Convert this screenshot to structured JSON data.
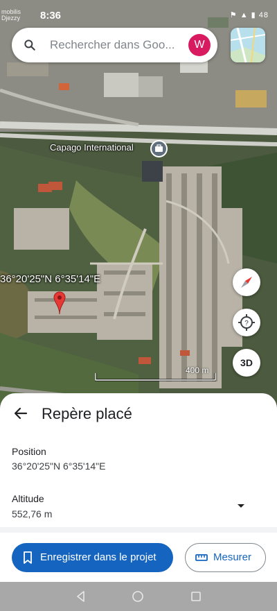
{
  "status": {
    "carrier": "mobilis\nDjezzy",
    "time": "8:36",
    "icons": "⚑ ▲ ▮ 48"
  },
  "search": {
    "placeholder": "Rechercher dans Goo...",
    "avatar_letter": "W"
  },
  "map": {
    "place_label": "Capago International",
    "coordinates_label": "36°20'25\"N 6°35'14\"E",
    "scale_label": "400 m",
    "button_3d": "3D"
  },
  "sheet": {
    "title": "Repère placé",
    "position_label": "Position",
    "position_value": "36°20'25\"N 6°35'14\"E",
    "altitude_label": "Altitude",
    "altitude_value": "552,76 m",
    "save_button": "Enregistrer dans le projet",
    "measure_button": "Mesurer"
  },
  "colors": {
    "accent": "#1565c0",
    "avatar": "#d81b60",
    "pin": "#e53935"
  }
}
